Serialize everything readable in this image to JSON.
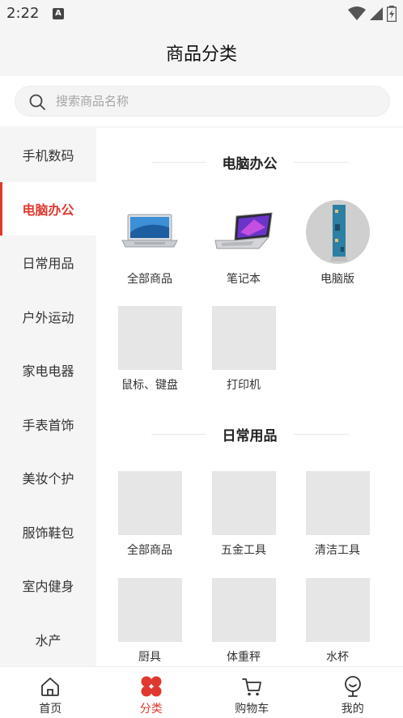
{
  "status_bar": {
    "time": "2:22",
    "notification_icon": "A"
  },
  "header": {
    "title": "商品分类"
  },
  "search": {
    "placeholder": "搜索商品名称"
  },
  "sidebar": {
    "items": [
      {
        "label": "手机数码",
        "active": false
      },
      {
        "label": "电脑办公",
        "active": true
      },
      {
        "label": "日常用品",
        "active": false
      },
      {
        "label": "户外运动",
        "active": false
      },
      {
        "label": "家电电器",
        "active": false
      },
      {
        "label": "手表首饰",
        "active": false
      },
      {
        "label": "美妆个护",
        "active": false
      },
      {
        "label": "服饰鞋包",
        "active": false
      },
      {
        "label": "室内健身",
        "active": false
      },
      {
        "label": "水产",
        "active": false
      }
    ]
  },
  "sections": [
    {
      "title": "电脑办公",
      "items": [
        {
          "label": "全部商品",
          "image": "laptop-silver-icon"
        },
        {
          "label": "笔记本",
          "image": "laptop-purple-icon"
        },
        {
          "label": "电脑版",
          "image": "circuit-board-icon"
        },
        {
          "label": "鼠标、键盘",
          "image": "placeholder"
        },
        {
          "label": "打印机",
          "image": "placeholder"
        }
      ]
    },
    {
      "title": "日常用品",
      "items": [
        {
          "label": "全部商品",
          "image": "placeholder"
        },
        {
          "label": "五金工具",
          "image": "placeholder"
        },
        {
          "label": "清洁工具",
          "image": "placeholder"
        },
        {
          "label": "厨具",
          "image": "placeholder"
        },
        {
          "label": "体重秤",
          "image": "placeholder"
        },
        {
          "label": "水杯",
          "image": "placeholder"
        }
      ]
    }
  ],
  "tabbar": {
    "items": [
      {
        "label": "首页",
        "icon": "home-icon",
        "active": false
      },
      {
        "label": "分类",
        "icon": "category-icon",
        "active": true
      },
      {
        "label": "购物车",
        "icon": "cart-icon",
        "active": false
      },
      {
        "label": "我的",
        "icon": "profile-icon",
        "active": false
      }
    ]
  },
  "colors": {
    "accent": "#e0382f",
    "background": "#f5f5f5",
    "placeholder": "#e6e6e6"
  }
}
